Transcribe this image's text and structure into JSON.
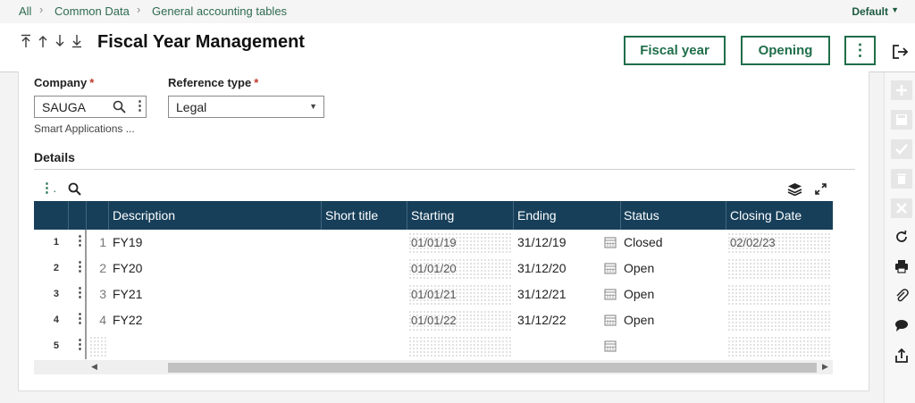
{
  "breadcrumb": {
    "items": [
      "All",
      "Common Data",
      "General accounting tables"
    ]
  },
  "view_selector": {
    "label": "Default"
  },
  "header": {
    "title": "Fiscal Year Management",
    "buttons": {
      "fiscal_year": "Fiscal year",
      "opening": "Opening"
    }
  },
  "form": {
    "company": {
      "label": "Company",
      "required_mark": "*",
      "value": "SAUGA",
      "description": "Smart Applications ..."
    },
    "reference_type": {
      "label": "Reference type",
      "required_mark": "*",
      "value": "Legal"
    }
  },
  "details": {
    "title": "Details",
    "columns": [
      "Description",
      "Short title",
      "Starting",
      "Ending",
      "Status",
      "Closing Date"
    ],
    "rows": [
      {
        "num": "1",
        "index": "1",
        "description": "FY19",
        "short_title": "",
        "starting": "01/01/19",
        "ending": "31/12/19",
        "status": "Closed",
        "closing_date": "02/02/23"
      },
      {
        "num": "2",
        "index": "2",
        "description": "FY20",
        "short_title": "",
        "starting": "01/01/20",
        "ending": "31/12/20",
        "status": "Open",
        "closing_date": ""
      },
      {
        "num": "3",
        "index": "3",
        "description": "FY21",
        "short_title": "",
        "starting": "01/01/21",
        "ending": "31/12/21",
        "status": "Open",
        "closing_date": ""
      },
      {
        "num": "4",
        "index": "4",
        "description": "FY22",
        "short_title": "",
        "starting": "01/01/22",
        "ending": "31/12/22",
        "status": "Open",
        "closing_date": ""
      },
      {
        "num": "5",
        "index": "",
        "description": "",
        "short_title": "",
        "starting": "",
        "ending": "",
        "status": "",
        "closing_date": ""
      }
    ]
  },
  "colors": {
    "accent": "#1f6e4a",
    "grid_header": "#173f5a",
    "breadcrumb_link": "#2e6b4e",
    "required": "#c0392b"
  },
  "icons": {
    "nav": [
      "first-record-icon",
      "previous-record-icon",
      "next-record-icon",
      "last-record-icon"
    ],
    "rail": [
      "add-icon",
      "save-icon",
      "check-icon",
      "delete-icon",
      "cancel-icon",
      "refresh-icon",
      "print-icon",
      "attachment-icon",
      "comment-icon",
      "export-icon"
    ]
  }
}
